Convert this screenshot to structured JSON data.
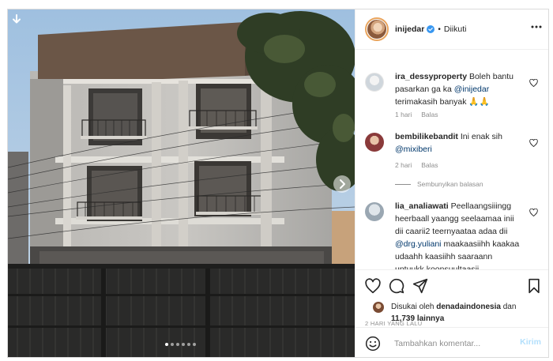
{
  "post": {
    "owner": {
      "username": "inijedar",
      "separator": "•",
      "follow_status": "Diikuti"
    },
    "carousel": {
      "slide_count": 6,
      "active_index": 0
    },
    "colors": {
      "accent_link": "#00376b",
      "secondary_text": "#8e8e8e",
      "story_ring": "#e9a45d",
      "post_button": "#b2dffc"
    }
  },
  "comments": [
    {
      "username": "ira_dessyproperty",
      "text_before": "Boleh bantu pasarkan ga ka ",
      "mention": "@inijedar",
      "text_after": " terimakasih banyak 🙏🙏",
      "time": "1 hari",
      "reply": "Balas"
    },
    {
      "username": "bembilikebandit",
      "text_before": "Ini enak sih ",
      "mention": "@mixiberi",
      "text_after": "",
      "time": "2 hari",
      "reply": "Balas"
    },
    {
      "username": "lia_analiawati",
      "text_before": "Peellaangsiiingg heerbaall yaangg seelaamaa inii dii caarii2 teernyaataa adaa dii ",
      "mention": "@drg.yuliani",
      "text_after": " maakaasiihh kaakaa udaahh kaasiihh saaraann untuukk koonsuultaasii",
      "time": "",
      "reply": ""
    }
  ],
  "hide_replies": "Sembunyikan balasan",
  "likes": {
    "prefix": "Disukai oleh ",
    "liker": "denadaindonesia",
    "middle": " dan ",
    "count": "11,739",
    "suffix": " lainnya"
  },
  "timestamp": "2 HARI YANG LALU",
  "add_comment": {
    "placeholder": "Tambahkan komentar...",
    "post_label": "Kirim"
  },
  "icons": {
    "download": "download-arrow-icon",
    "next": "chevron-right-icon",
    "verified": "verified-badge-icon",
    "more": "more-horizontal-icon",
    "like": "heart-icon",
    "comment": "comment-bubble-icon",
    "share": "paper-plane-icon",
    "save": "bookmark-icon",
    "emoji": "emoji-smile-icon"
  }
}
